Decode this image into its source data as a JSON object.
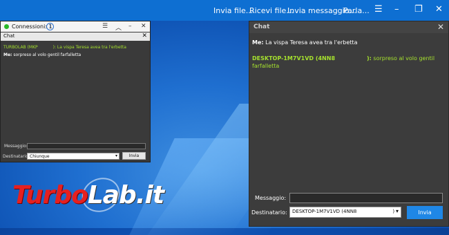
{
  "topbar": {
    "send_file": "Invia file...",
    "receive_file": "Ricevi file...",
    "send_message": "Invia messaggio...",
    "talk": "Parla...",
    "icons": [
      "list-icon",
      "minimize-icon",
      "restore-icon",
      "close-icon"
    ]
  },
  "left_window": {
    "connections_label": "Connessioni: 1",
    "chat_title": "Chat",
    "messages": [
      {
        "sender": "TURBOLAB (MKP",
        "suffix": "):",
        "text": " La vispa Teresa avea tra l'erbetta"
      },
      {
        "sender": "Me:",
        "text": " sorpreso al volo gentil farfalletta"
      }
    ],
    "message_label": "Messaggio:",
    "recipient_label": "Destinatario:",
    "recipient_value": "Chiunque",
    "send_button": "Invia"
  },
  "logo": {
    "part1": "Turbo",
    "part2": "Lab.it"
  },
  "right_window": {
    "title": "Chat",
    "messages": [
      {
        "sender": "Me:",
        "text": " La vispa Teresa avea tra l'erbetta"
      },
      {
        "sender": "DESKTOP-1M7V1VD (4NN8",
        "suffix": "):",
        "text": " sorpreso al volo gentil",
        "text2": "farfalletta"
      }
    ],
    "message_label": "Messaggio:",
    "recipient_label": "Destinatario:",
    "recipient_value": "DESKTOP-1M7V1VD (4NN8",
    "recipient_value_end": ")",
    "send_button": "Invia"
  },
  "colors": {
    "accent": "#1f87e6",
    "sender_green": "#a6e22e",
    "status_green": "#28b828",
    "logo_red": "#e52020"
  }
}
